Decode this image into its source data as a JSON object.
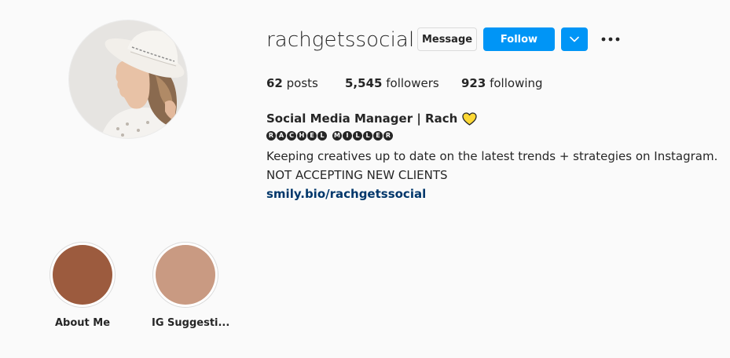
{
  "profile": {
    "username": "rachgetssocial",
    "buttons": {
      "message": "Message",
      "follow": "Follow"
    },
    "stats": {
      "posts_count": "62",
      "posts_label": "posts",
      "followers_count": "5,545",
      "followers_label": "followers",
      "following_count": "923",
      "following_label": "following"
    },
    "bio": {
      "name": "Social Media Manager | Rach",
      "name_emoji": "yellow-heart",
      "circled_name_first": [
        "R",
        "A",
        "C",
        "H",
        "E",
        "L"
      ],
      "circled_name_last": [
        "M",
        "I",
        "L",
        "L",
        "E",
        "R"
      ],
      "line1": "Keeping creatives up to date on the latest trends + strategies on Instagram.",
      "line2": "NOT ACCEPTING NEW CLIENTS",
      "link": "smily.bio/rachgetssocial"
    }
  },
  "highlights": [
    {
      "label": "About Me",
      "color": "#9c5b3e"
    },
    {
      "label": "IG Suggesti...",
      "color": "#c99a82"
    }
  ],
  "colors": {
    "primary_blue": "#0095f6",
    "link_blue": "#00376b",
    "text": "#262626",
    "border": "#dbdbdb",
    "background": "#fafafa",
    "heart_yellow": "#fdd835"
  }
}
